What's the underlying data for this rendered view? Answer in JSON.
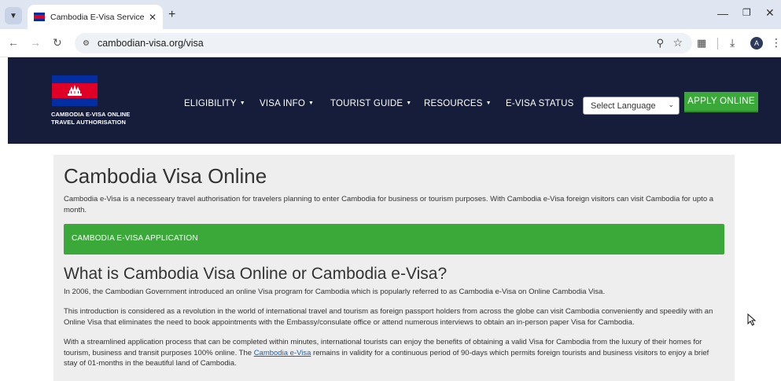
{
  "browser": {
    "tab_title": "Cambodia E-Visa Service | Appli",
    "url": "cambodian-visa.org/visa",
    "avatar_letter": "A"
  },
  "header": {
    "brand_line1": "CAMBODIA E-VISA ONLINE",
    "brand_line2": "TRAVEL AUTHORISATION",
    "nav": [
      {
        "label": "ELIGIBILITY",
        "has_dropdown": true
      },
      {
        "label": "VISA INFO",
        "has_dropdown": true
      },
      {
        "label": "TOURIST GUIDE",
        "has_dropdown": true
      },
      {
        "label": "RESOURCES",
        "has_dropdown": true
      },
      {
        "label": "E-VISA STATUS",
        "has_dropdown": false
      }
    ],
    "language_select": "Select Language",
    "apply_button": "APPLY ONLINE"
  },
  "main": {
    "title": "Cambodia Visa Online",
    "intro": "Cambodia e-Visa is a necesseary travel authorisation for travelers planning to enter Cambodia for business or tourism purposes. With Cambodia e-Visa foreign visitors can visit Cambodia for upto a month.",
    "application_bar": "CAMBODIA E-VISA APPLICATION",
    "subtitle": "What is Cambodia Visa Online or Cambodia e-Visa?",
    "para1": "In 2006, the Cambodian Government introduced an online Visa program for Cambodia which is popularly referred to as Cambodia e-Visa on Online Cambodia Visa.",
    "para2": "This introduction is considered as a revolution in the world of international travel and tourism as foreign passport holders from across the globe can visit Cambodia conveniently and speedily with an Online Visa that eliminates the need to book appointments with the Embassy/consulate office or attend numerous interviews to obtain an in-person paper Visa for Cambodia.",
    "para3_before": "With a streamlined application process that can be completed within minutes, international tourists can enjoy the benefits of obtaining a valid Visa for Cambodia from the luxury of their homes for tourism, business and transit purposes 100% online. The ",
    "para3_link": "Cambodia e-Visa",
    "para3_after": " remains in validity for a continuous period of 90-days which permits foreign tourists and business visitors to enjoy a brief stay of 01-months in the beautiful land of Cambodia."
  }
}
